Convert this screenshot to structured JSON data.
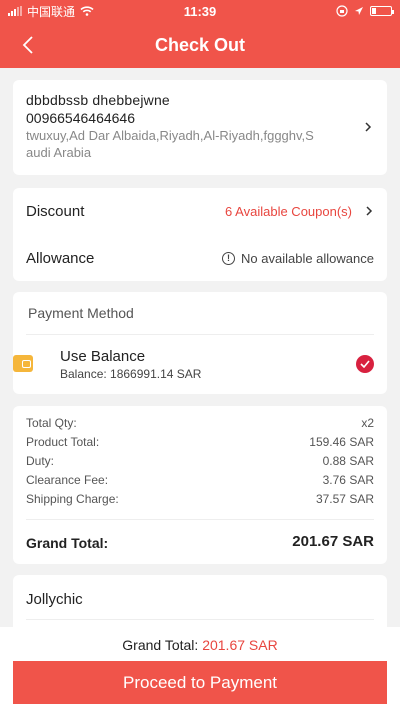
{
  "status_bar": {
    "carrier": "中国联通",
    "time": "11:39"
  },
  "header": {
    "title": "Check Out"
  },
  "address": {
    "name": "dbbdbssb  dhebbejwne",
    "phone": "00966546464646",
    "line1": "twuxuy,Ad Dar Albaida,Riyadh,Al-Riyadh,fggghv,S",
    "line2": "audi Arabia"
  },
  "discount": {
    "label": "Discount",
    "value": "6 Available Coupon(s)"
  },
  "allowance": {
    "label": "Allowance",
    "value": "No available allowance"
  },
  "payment": {
    "title": "Payment Method",
    "method_name": "Use Balance",
    "balance": "Balance: 1866991.14 SAR"
  },
  "summary": {
    "rows": [
      {
        "label": "Total Qty:",
        "value": "x2"
      },
      {
        "label": "Product Total:",
        "value": "159.46 SAR"
      },
      {
        "label": "Duty:",
        "value": "0.88 SAR"
      },
      {
        "label": "Clearance Fee:",
        "value": "3.76 SAR"
      },
      {
        "label": "Shipping Charge:",
        "value": "37.57 SAR"
      }
    ],
    "grand_label": "Grand Total:",
    "grand_value": "201.67 SAR"
  },
  "store": {
    "name": "Jollychic"
  },
  "bottom": {
    "grand_label": "Grand Total: ",
    "grand_value": "201.67 SAR",
    "button_label": "Proceed to Payment"
  },
  "colors": {
    "brand": "#f0544a",
    "accent_text": "#e8463f",
    "check": "#d8213f",
    "wallet": "#f5b63b"
  }
}
